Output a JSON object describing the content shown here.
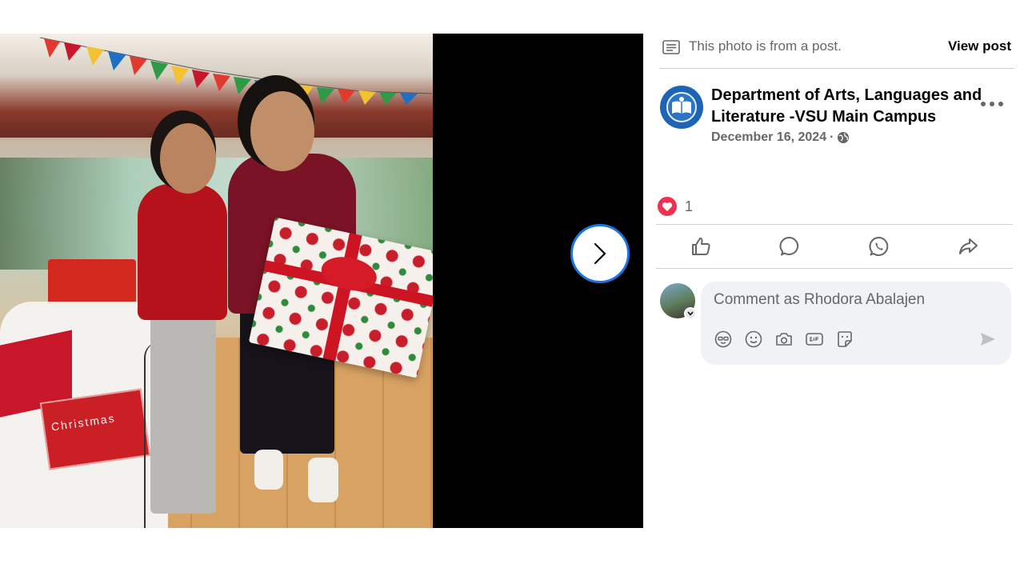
{
  "viewer": {
    "next_label": "Next photo",
    "gift_text": "Christmas"
  },
  "panel": {
    "post_note": "This photo is from a post.",
    "view_post": "View post",
    "page_name": "Department of Arts, Languages and Literature -VSU Main Campus",
    "date": "December 16, 2024",
    "date_separator": "·",
    "audience_icon": "globe-icon",
    "reaction_count": "1",
    "actions": [
      "like-icon",
      "comment-icon",
      "whatsapp-icon",
      "share-icon"
    ],
    "comment_placeholder": "Comment as Rhodora Abalajen",
    "comment_tools": [
      "avatar-sticker-icon",
      "emoji-icon",
      "camera-icon",
      "gif-icon",
      "sticker-icon"
    ]
  },
  "colors": {
    "accent": "#1b74e4",
    "heart": "#f0314d",
    "secondary_text": "#65676b",
    "input_bg": "#f0f2f5"
  }
}
